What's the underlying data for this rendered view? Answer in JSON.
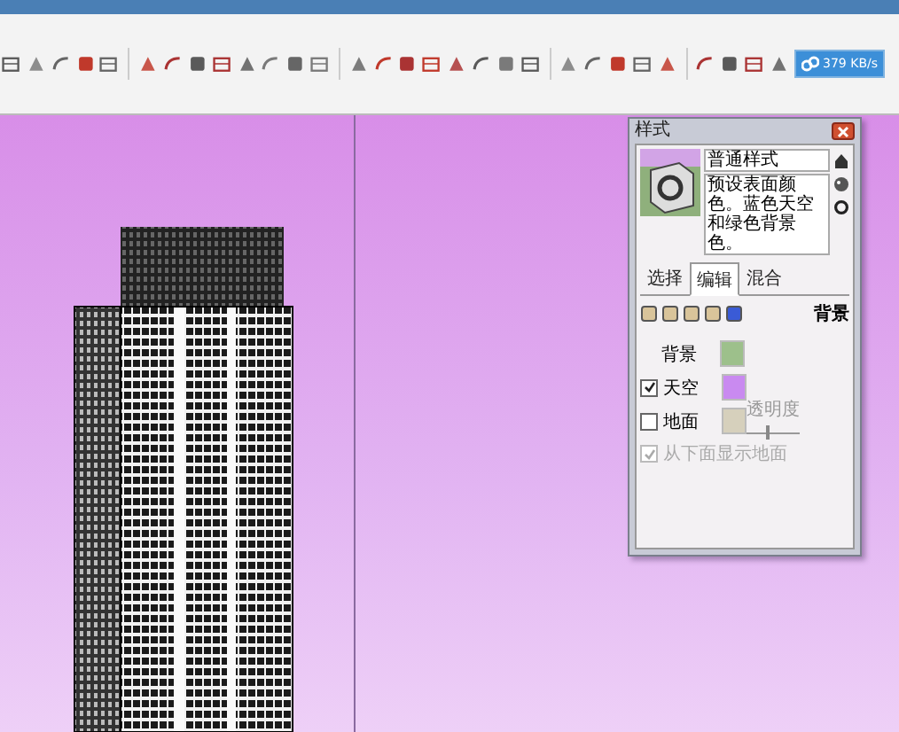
{
  "toolbar": {
    "speed_badge": "379 KB/s"
  },
  "styles_panel": {
    "title": "样式",
    "style_name": "普通样式",
    "description": "预设表面颜色。蓝色天空和绿色背景色。",
    "tabs": [
      {
        "label": "选择",
        "selected": false
      },
      {
        "label": "编辑",
        "selected": true
      },
      {
        "label": "混合",
        "selected": false
      }
    ],
    "section_label": "背景",
    "settings": [
      {
        "kind": "color",
        "label": "背景",
        "color": "#9dc08b"
      },
      {
        "kind": "check-color",
        "label": "天空",
        "checked": true,
        "color": "#c98af0"
      },
      {
        "kind": "check-color",
        "label": "地面",
        "checked": false,
        "color": "#d6d0bc"
      },
      {
        "kind": "check",
        "label": "从下面显示地面",
        "checked": true,
        "disabled": true
      }
    ],
    "transparency": {
      "label": "透明度",
      "level": 0.4
    }
  }
}
